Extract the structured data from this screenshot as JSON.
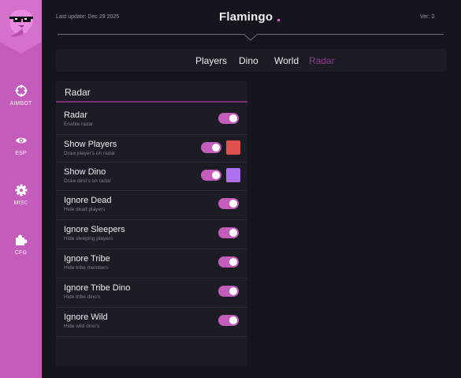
{
  "header": {
    "last_update": "Last update: Dec 29 2025",
    "brand": "Flamingo",
    "version": "Ver: 2"
  },
  "sidebar": {
    "items": [
      {
        "label": "AIMBOT",
        "icon": "crosshair-icon"
      },
      {
        "label": "ESP",
        "icon": "eye-icon"
      },
      {
        "label": "MISC",
        "icon": "gear-icon"
      },
      {
        "label": "CFG",
        "icon": "puzzle-icon"
      }
    ]
  },
  "tabs": [
    "Players",
    "Dino",
    "World",
    "Radar"
  ],
  "active_tab": "Radar",
  "panel": {
    "title": "Radar",
    "rows": [
      {
        "label": "Radar",
        "desc": "Enable radar",
        "enabled": true
      },
      {
        "label": "Show Players",
        "desc": "Draw player's on radar",
        "enabled": true,
        "color": "#e0504c"
      },
      {
        "label": "Show Dino",
        "desc": "Draw dino's on radar",
        "enabled": true,
        "color": "#ad70ee"
      },
      {
        "label": "Ignore Dead",
        "desc": "Hide dead players",
        "enabled": true
      },
      {
        "label": "Ignore Sleepers",
        "desc": "Hide sleeping players",
        "enabled": true
      },
      {
        "label": "Ignore Tribe",
        "desc": "Hide tribe members",
        "enabled": true
      },
      {
        "label": "Ignore Tribe Dino",
        "desc": "Hide tribe dino's",
        "enabled": true
      },
      {
        "label": "Ignore Wild",
        "desc": "Hide wild dino's",
        "enabled": true
      }
    ]
  },
  "colors": {
    "accent": "#c45cbc",
    "sidebar": "#c45cbc",
    "background": "#15151d",
    "panel": "#1c1c25",
    "active_tab": "#8e3e8a"
  }
}
